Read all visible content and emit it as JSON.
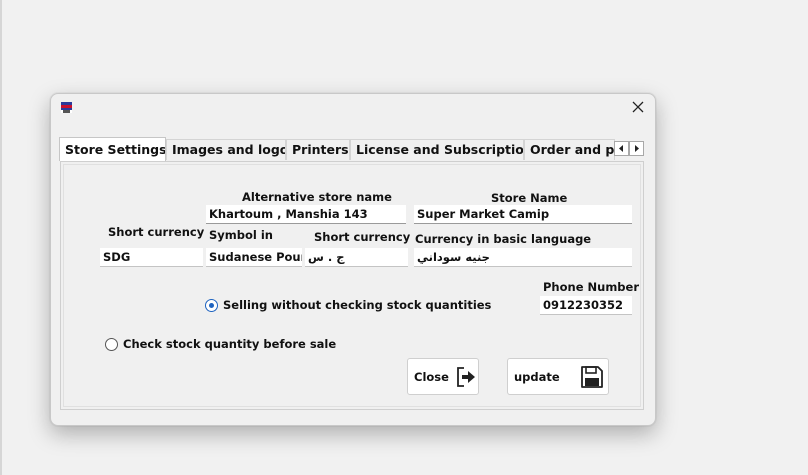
{
  "tabs": [
    {
      "label": "Store Settings",
      "active": true
    },
    {
      "label": "Images and logo",
      "active": false
    },
    {
      "label": "Printers",
      "active": false
    },
    {
      "label": "License and Subscription",
      "active": false
    },
    {
      "label": "Order and pu",
      "active": false
    }
  ],
  "form": {
    "alt_store_name_label": "Alternative store name",
    "alt_store_name_value": "Khartoum , Manshia 143",
    "store_name_label": "Store Name",
    "store_name_value": "Super Market Camip",
    "short_currency_left_label": "Short currency",
    "short_currency_left_value": "SDG",
    "symbol_in_label": "Symbol in",
    "symbol_in_value": "Sudanese Pound",
    "short_currency_mid_label": "Short currency",
    "short_currency_mid_value": "ج . س",
    "currency_basic_label": "Currency in basic language",
    "currency_basic_value": "جنيه سوداني",
    "phone_label": "Phone Number",
    "phone_value": "0912230352"
  },
  "options": {
    "selling_without_check": {
      "label": "Selling without checking stock quantities",
      "selected": true
    },
    "check_before_sale": {
      "label": "Check stock quantity before sale",
      "selected": false
    }
  },
  "buttons": {
    "close_label": "Close",
    "update_label": "update"
  },
  "icons": {
    "app": "app-icon",
    "window_close": "close-icon",
    "tab_left": "chevron-left-icon",
    "tab_right": "chevron-right-icon",
    "close_button": "exit-arrow-icon",
    "update_button": "floppy-disk-icon"
  },
  "colors": {
    "radio_selected": "#1e63c0",
    "background": "#f1f1f1"
  }
}
